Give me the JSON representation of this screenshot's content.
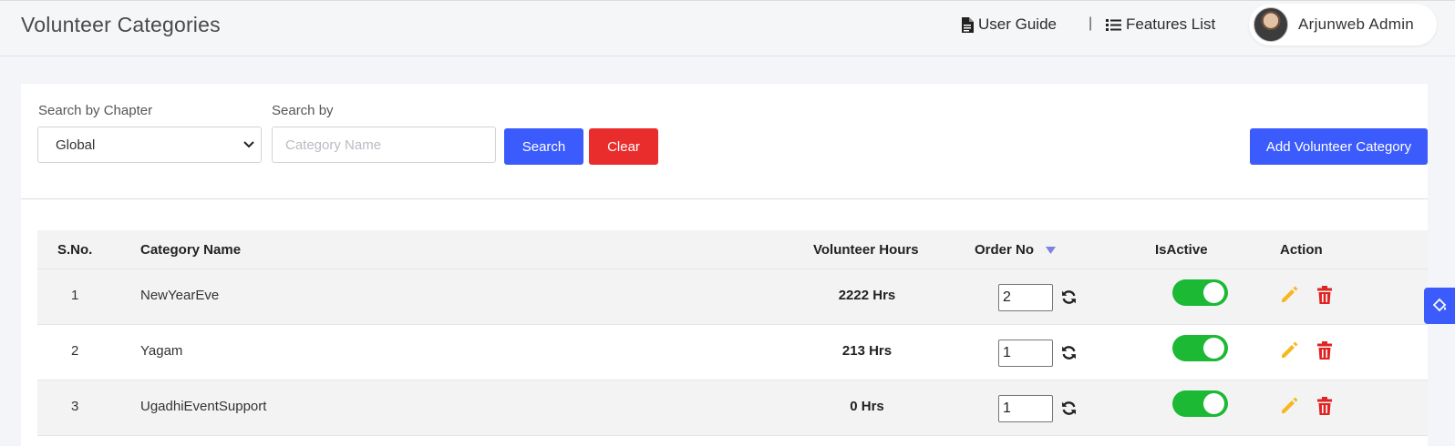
{
  "header": {
    "title": "Volunteer Categories",
    "user_guide_label": "User Guide",
    "separator": "|",
    "features_label": "Features List",
    "user_name": "Arjunweb Admin"
  },
  "filters": {
    "chapter_label": "Search by Chapter",
    "chapter_value": "Global",
    "search_by_label": "Search by",
    "search_placeholder": "Category Name",
    "search_button": "Search",
    "clear_button": "Clear",
    "add_button": "Add Volunteer Category"
  },
  "table": {
    "columns": {
      "sno": "S.No.",
      "name": "Category Name",
      "hours": "Volunteer Hours",
      "order": "Order No",
      "active": "IsActive",
      "action": "Action"
    },
    "sort_column": "order",
    "rows": [
      {
        "sno": "1",
        "name": "NewYearEve",
        "hours": "2222 Hrs",
        "order": "2",
        "active": true
      },
      {
        "sno": "2",
        "name": "Yagam",
        "hours": "213 Hrs",
        "order": "1",
        "active": true
      },
      {
        "sno": "3",
        "name": "UgadhiEventSupport",
        "hours": "0 Hrs",
        "order": "1",
        "active": true
      }
    ]
  },
  "colors": {
    "primary": "#3b5bfd",
    "danger": "#e92c2c",
    "toggle_on": "#1bb934",
    "edit_icon": "#f5b820",
    "delete_icon": "#e02424",
    "sort_arrow": "#7b82e0"
  },
  "icons": {
    "user_guide": "file-icon",
    "features": "list-icon",
    "select": "chevron-down-icon",
    "sort": "caret-down-icon",
    "refresh": "refresh-icon",
    "edit": "pencil-icon",
    "delete": "trash-icon",
    "side_tab": "paint-bucket-icon"
  }
}
